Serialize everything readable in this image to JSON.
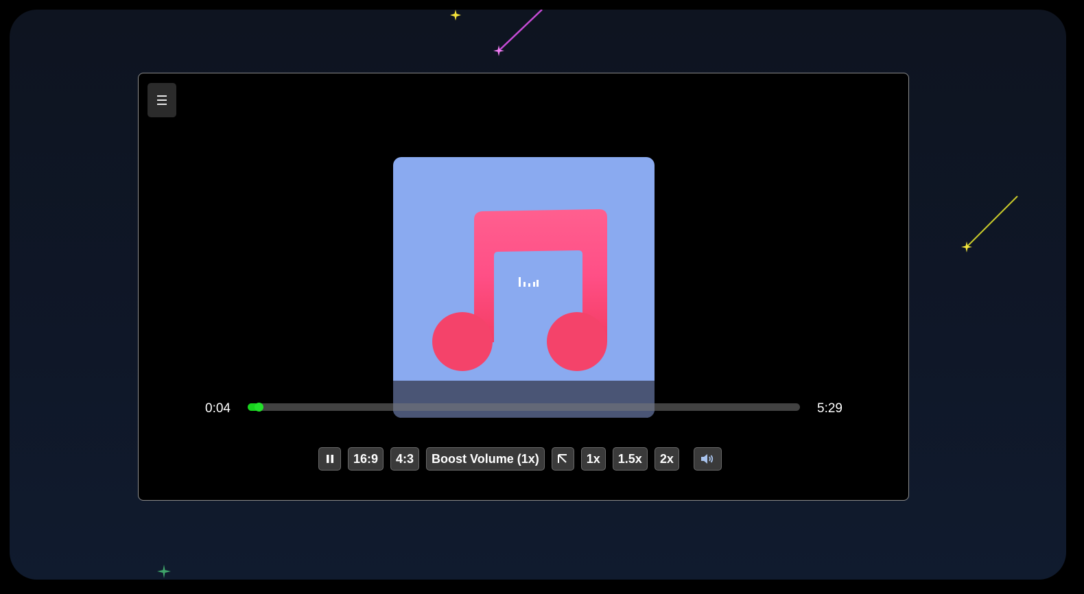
{
  "player": {
    "menu_icon": "hamburger-menu-icon",
    "current_time": "0:04",
    "total_time": "5:29",
    "progress": 0.013,
    "progress_color": "#18d21e",
    "artwork": {
      "background": "#8aaaf0",
      "icon": "music-note-icon",
      "overlay_icon": "equalizer-bars-icon"
    },
    "controls": {
      "play_pause_icon": "pause-icon",
      "aspect_16_9": "16:9",
      "aspect_4_3": "4:3",
      "boost_volume": "Boost Volume (1x)",
      "pip_icon": "arrow-up-left-icon",
      "speed_1x": "1x",
      "speed_1_5x": "1.5x",
      "speed_2x": "2x",
      "volume_icon": "speaker-icon"
    }
  },
  "background": {
    "decorations": [
      "shooting-star-icon",
      "sparkle-icon"
    ]
  }
}
